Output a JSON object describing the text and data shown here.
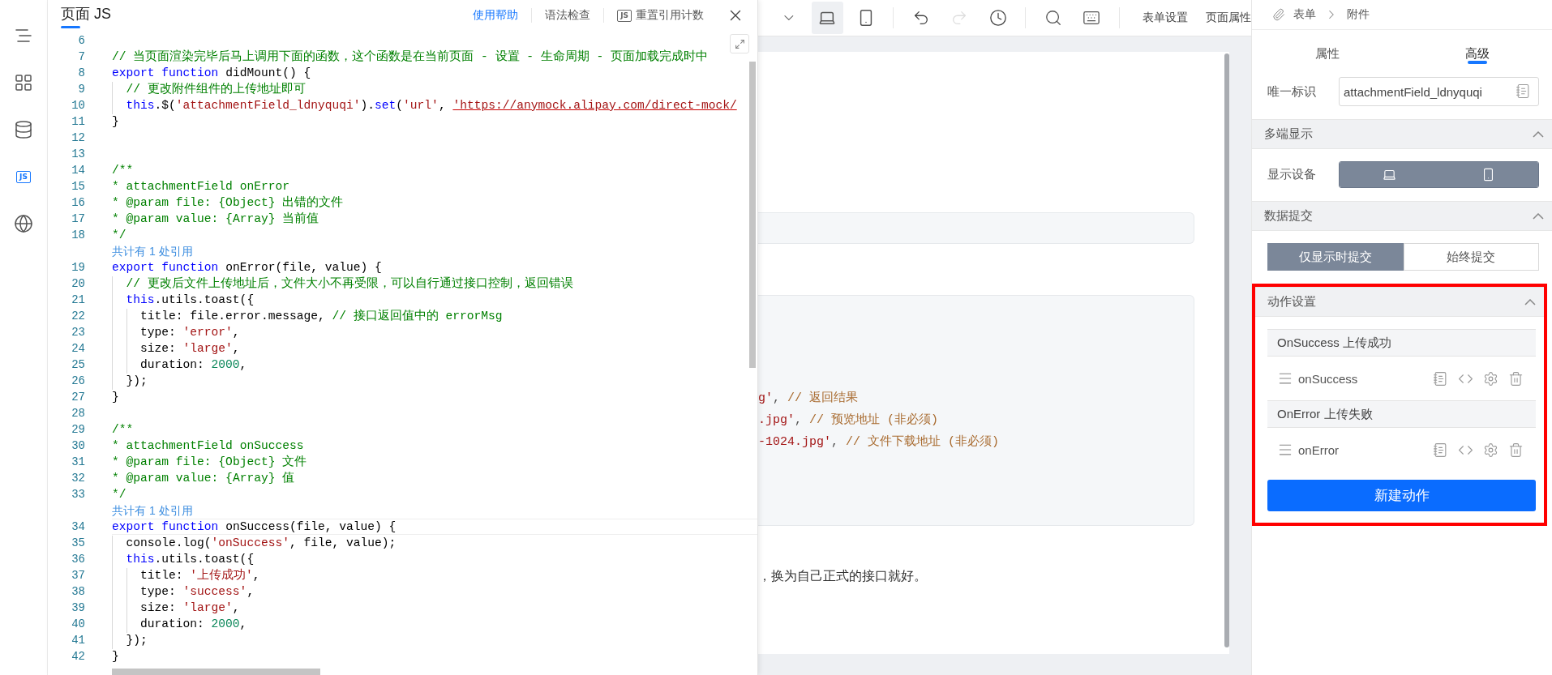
{
  "sidebar": {
    "items": [
      {
        "kind": "outline",
        "selected": false
      },
      {
        "kind": "components",
        "selected": false
      },
      {
        "kind": "data",
        "selected": false
      },
      {
        "kind": "js",
        "label": "JS",
        "selected": true
      },
      {
        "kind": "globe",
        "selected": false
      }
    ]
  },
  "editor": {
    "title": "页面 JS",
    "actions": [
      {
        "kind": "link",
        "label": "使用帮助"
      },
      {
        "kind": "plain",
        "label": "语法检查"
      },
      {
        "kind": "badge",
        "badge": "JS",
        "label": "重置引用计数"
      }
    ],
    "lines": [
      {
        "kind": "code",
        "no": "6",
        "current": false
      },
      {
        "kind": "code",
        "no": "7",
        "current": false,
        "tokens": [
          {
            "kind": "comment",
            "text": "// 当页面渲染完毕后马上调用下面的函数，这个函数是在当前页面 - 设置 - 生命周期 - 页面加载完成时中"
          }
        ]
      },
      {
        "kind": "code",
        "no": "8",
        "current": false,
        "tokens": [
          {
            "kind": "keyword",
            "text": "export function"
          },
          {
            "kind": "plain",
            "text": " didMount() {"
          }
        ]
      },
      {
        "kind": "code",
        "no": "9",
        "current": false,
        "tokens": [
          {
            "kind": "comment",
            "text": "  // 更改附件组件的上传地址即可"
          }
        ]
      },
      {
        "kind": "code",
        "no": "10",
        "current": false,
        "tokens": [
          {
            "kind": "keyword",
            "text": "  this"
          },
          {
            "kind": "plain",
            "text": ".$("
          },
          {
            "kind": "string",
            "text": "'attachmentField_ldnyquqi'"
          },
          {
            "kind": "plain",
            "text": ")."
          },
          {
            "kind": "keyword",
            "text": "set"
          },
          {
            "kind": "plain",
            "text": "("
          },
          {
            "kind": "string",
            "text": "'url'"
          },
          {
            "kind": "plain",
            "text": ", "
          },
          {
            "kind": "url",
            "text": "'https://anymock.alipay.com/direct-mock/"
          }
        ]
      },
      {
        "kind": "code",
        "no": "11",
        "current": false,
        "tokens": [
          {
            "kind": "plain",
            "text": "}"
          }
        ]
      },
      {
        "kind": "code",
        "no": "12",
        "current": false
      },
      {
        "kind": "code",
        "no": "13",
        "current": false
      },
      {
        "kind": "code",
        "no": "14",
        "current": false,
        "tokens": [
          {
            "kind": "comment",
            "text": "/**"
          }
        ]
      },
      {
        "kind": "code",
        "no": "15",
        "current": false,
        "tokens": [
          {
            "kind": "comment",
            "text": "* attachmentField onError"
          }
        ]
      },
      {
        "kind": "code",
        "no": "16",
        "current": false,
        "tokens": [
          {
            "kind": "comment",
            "text": "* @param file: {Object} 出错的文件"
          }
        ]
      },
      {
        "kind": "code",
        "no": "17",
        "current": false,
        "tokens": [
          {
            "kind": "comment",
            "text": "* @param value: {Array} 当前值"
          }
        ]
      },
      {
        "kind": "code",
        "no": "18",
        "current": false,
        "tokens": [
          {
            "kind": "comment",
            "text": "*/"
          }
        ]
      },
      {
        "kind": "ref",
        "text": "共计有 1 处引用"
      },
      {
        "kind": "code",
        "no": "19",
        "current": false,
        "tokens": [
          {
            "kind": "keyword",
            "text": "export function"
          },
          {
            "kind": "plain",
            "text": " onError(file, value) {"
          }
        ]
      },
      {
        "kind": "code",
        "no": "20",
        "current": false,
        "tokens": [
          {
            "kind": "comment",
            "text": "  // 更改后文件上传地址后，文件大小不再受限，可以自行通过接口控制，返回错误"
          }
        ]
      },
      {
        "kind": "code",
        "no": "21",
        "current": false,
        "tokens": [
          {
            "kind": "keyword",
            "text": "  this"
          },
          {
            "kind": "plain",
            "text": ".utils.toast({"
          }
        ]
      },
      {
        "kind": "code",
        "no": "22",
        "current": false,
        "tokens": [
          {
            "kind": "plain",
            "text": "    title: file.error.message, "
          },
          {
            "kind": "comment",
            "text": "// 接口返回值中的 errorMsg"
          }
        ]
      },
      {
        "kind": "code",
        "no": "23",
        "current": false,
        "tokens": [
          {
            "kind": "plain",
            "text": "    type: "
          },
          {
            "kind": "string",
            "text": "'error'"
          },
          {
            "kind": "plain",
            "text": ","
          }
        ]
      },
      {
        "kind": "code",
        "no": "24",
        "current": false,
        "tokens": [
          {
            "kind": "plain",
            "text": "    size: "
          },
          {
            "kind": "string",
            "text": "'large'"
          },
          {
            "kind": "plain",
            "text": ","
          }
        ]
      },
      {
        "kind": "code",
        "no": "25",
        "current": false,
        "tokens": [
          {
            "kind": "plain",
            "text": "    duration: "
          },
          {
            "kind": "number",
            "text": "2000"
          },
          {
            "kind": "plain",
            "text": ","
          }
        ]
      },
      {
        "kind": "code",
        "no": "26",
        "current": false,
        "tokens": [
          {
            "kind": "plain",
            "text": "  });"
          }
        ]
      },
      {
        "kind": "code",
        "no": "27",
        "current": false,
        "tokens": [
          {
            "kind": "plain",
            "text": "}"
          }
        ]
      },
      {
        "kind": "code",
        "no": "28",
        "current": false
      },
      {
        "kind": "code",
        "no": "29",
        "current": false,
        "tokens": [
          {
            "kind": "comment",
            "text": "/**"
          }
        ]
      },
      {
        "kind": "code",
        "no": "30",
        "current": false,
        "tokens": [
          {
            "kind": "comment",
            "text": "* attachmentField onSuccess"
          }
        ]
      },
      {
        "kind": "code",
        "no": "31",
        "current": false,
        "tokens": [
          {
            "kind": "comment",
            "text": "* @param file: {Object} 文件"
          }
        ]
      },
      {
        "kind": "code",
        "no": "32",
        "current": false,
        "tokens": [
          {
            "kind": "comment",
            "text": "* @param value: {Array} 值"
          }
        ]
      },
      {
        "kind": "code",
        "no": "33",
        "current": false,
        "tokens": [
          {
            "kind": "comment",
            "text": "*/"
          }
        ]
      },
      {
        "kind": "ref",
        "text": "共计有 1 处引用"
      },
      {
        "kind": "code",
        "no": "34",
        "current": true,
        "tokens": [
          {
            "kind": "keyword",
            "text": "export function"
          },
          {
            "kind": "plain",
            "text": " onSuccess(file, value) {"
          }
        ]
      },
      {
        "kind": "code",
        "no": "35",
        "current": false,
        "tokens": [
          {
            "kind": "plain",
            "text": "  console.log("
          },
          {
            "kind": "string",
            "text": "'onSuccess'"
          },
          {
            "kind": "plain",
            "text": ", file, value);"
          }
        ]
      },
      {
        "kind": "code",
        "no": "36",
        "current": false,
        "tokens": [
          {
            "kind": "keyword",
            "text": "  this"
          },
          {
            "kind": "plain",
            "text": ".utils.toast({"
          }
        ]
      },
      {
        "kind": "code",
        "no": "37",
        "current": false,
        "tokens": [
          {
            "kind": "plain",
            "text": "    title: "
          },
          {
            "kind": "string",
            "text": "'上传成功'"
          },
          {
            "kind": "plain",
            "text": ","
          }
        ]
      },
      {
        "kind": "code",
        "no": "38",
        "current": false,
        "tokens": [
          {
            "kind": "plain",
            "text": "    type: "
          },
          {
            "kind": "string",
            "text": "'success'"
          },
          {
            "kind": "plain",
            "text": ","
          }
        ]
      },
      {
        "kind": "code",
        "no": "39",
        "current": false,
        "tokens": [
          {
            "kind": "plain",
            "text": "    size: "
          },
          {
            "kind": "string",
            "text": "'large'"
          },
          {
            "kind": "plain",
            "text": ","
          }
        ]
      },
      {
        "kind": "code",
        "no": "40",
        "current": false,
        "tokens": [
          {
            "kind": "plain",
            "text": "    duration: "
          },
          {
            "kind": "number",
            "text": "2000"
          },
          {
            "kind": "plain",
            "text": ","
          }
        ]
      },
      {
        "kind": "code",
        "no": "41",
        "current": false,
        "tokens": [
          {
            "kind": "plain",
            "text": "  });"
          }
        ]
      },
      {
        "kind": "code",
        "no": "42",
        "current": false,
        "tokens": [
          {
            "kind": "plain",
            "text": "}"
          }
        ]
      }
    ]
  },
  "toolbar": {
    "devices": [
      {
        "kind": "desktop",
        "selected": true
      },
      {
        "kind": "mobile",
        "selected": false
      }
    ],
    "history": [
      {
        "kind": "undo",
        "disabled": false
      },
      {
        "kind": "redo",
        "disabled": true
      },
      {
        "kind": "clock",
        "disabled": false
      }
    ],
    "tools": [
      {
        "kind": "search"
      },
      {
        "kind": "keyboard"
      }
    ],
    "links": [
      "表单设置",
      "页面属性"
    ]
  },
  "canvas": {
    "code_lines": [
      [
        {
          "kind": "string",
          "text": "g'"
        },
        {
          "kind": "plain",
          "text": ", "
        },
        {
          "kind": "comment",
          "text": "// 返回结果"
        }
      ],
      [
        {
          "kind": "string",
          "text": ".jpg'"
        },
        {
          "kind": "plain",
          "text": ", "
        },
        {
          "kind": "comment",
          "text": "// 预览地址 (非必须)"
        }
      ],
      [
        {
          "kind": "string",
          "text": "-1024.jpg'"
        },
        {
          "kind": "plain",
          "text": ", "
        },
        {
          "kind": "comment",
          "text": "// 文件下载地址 (非必须)"
        }
      ]
    ],
    "note": "，换为自己正式的接口就好。"
  },
  "inspector": {
    "breadcrumb": [
      "表单",
      "附件"
    ],
    "tabs": [
      {
        "label": "属性",
        "selected": false
      },
      {
        "label": "高级",
        "selected": true
      }
    ],
    "id_field": {
      "label": "唯一标识",
      "value": "attachmentField_ldnyquqi"
    },
    "sections": [
      {
        "kind": "devices",
        "title": "多端显示",
        "expanded": true,
        "highlighted": false,
        "label": "显示设备",
        "devices": [
          {
            "kind": "desktop",
            "selected": true
          },
          {
            "kind": "mobile",
            "selected": true
          }
        ]
      },
      {
        "kind": "segment",
        "title": "数据提交",
        "expanded": true,
        "highlighted": false,
        "options": [
          {
            "label": "仅显示时提交",
            "selected": true
          },
          {
            "label": "始终提交",
            "selected": false
          }
        ]
      },
      {
        "kind": "actions",
        "title": "动作设置",
        "expanded": true,
        "highlighted": true,
        "groups": [
          {
            "title": "OnSuccess 上传成功",
            "action": "onSuccess"
          },
          {
            "title": "OnError 上传失败",
            "action": "onError"
          }
        ],
        "button": "新建动作"
      }
    ]
  }
}
